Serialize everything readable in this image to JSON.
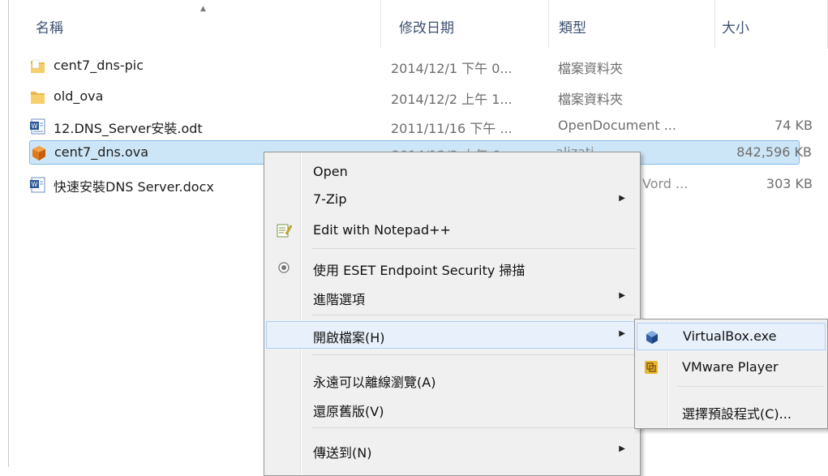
{
  "columns": {
    "name": "名稱",
    "date": "修改日期",
    "type": "類型",
    "size": "大小"
  },
  "files": [
    {
      "name": "cent7_dns-pic",
      "date": "2014/12/1 下午 0...",
      "type": "檔案資料夾",
      "size": "",
      "icon": "folder-icon"
    },
    {
      "name": "old_ova",
      "date": "2014/12/2 上午 1...",
      "type": "檔案資料夾",
      "size": "",
      "icon": "folder-icon"
    },
    {
      "name": "12.DNS_Server安裝.odt",
      "date": "2011/11/16 下午 ...",
      "type": "OpenDocument ...",
      "size": "74 KB",
      "icon": "word-document-icon"
    },
    {
      "name": "cent7_dns.ova",
      "date": "",
      "type": "alizati...",
      "size": "842,596 KB",
      "icon": "virtualbox-ova-icon"
    },
    {
      "name": "快速安裝DNS Server.docx",
      "date": "",
      "type": "Vord ...",
      "size": "303 KB",
      "icon": "word-document-icon"
    }
  ],
  "context_menu": {
    "open": "Open",
    "zip": "7-Zip",
    "notepad": "Edit with Notepad++",
    "eset": "使用 ESET Endpoint Security 掃描",
    "advanced": "進階選項",
    "open_with": "開啟檔案(H)",
    "offline": "永遠可以離線瀏覽(A)",
    "restore": "還原舊版(V)",
    "send_to": "傳送到(N)"
  },
  "submenu": {
    "virtualbox": "VirtualBox.exe",
    "vmware": "VMware Player",
    "choose": "選擇預設程式(C)..."
  },
  "colors": {
    "selection": "#cce6f7",
    "header_text": "#3c4f72",
    "menu_bg": "#f0f0f0"
  }
}
